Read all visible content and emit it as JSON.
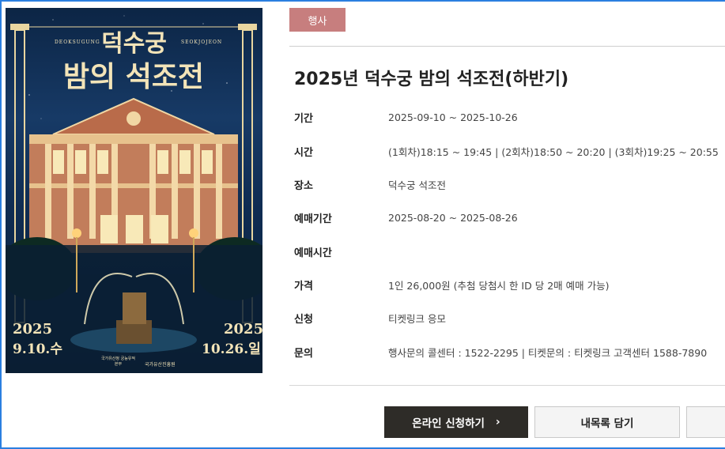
{
  "poster": {
    "title_line1": "덕수궁",
    "title_line2": "밤의 석조전",
    "en_left": "DEOKSUGUNG",
    "en_right": "SEOKJOJEON",
    "start_year": "2025",
    "start_date": "9.10.수",
    "end_year": "2025",
    "end_date": "10.26.일",
    "logo_left": "국가유산청 궁능유적본부",
    "logo_right": "국가유산진흥원"
  },
  "badge": "행사",
  "event_title": "2025년 덕수궁 밤의 석조전(하반기)",
  "info": [
    {
      "label": "기간",
      "value": "2025-09-10 ~ 2025-10-26"
    },
    {
      "label": "시간",
      "value": "(1회차)18:15 ~ 19:45 | (2회차)18:50 ~ 20:20 | (3회차)19:25 ~ 20:55"
    },
    {
      "label": "장소",
      "value": "덕수궁 석조전"
    },
    {
      "label": "예매기간",
      "value": "2025-08-20 ~ 2025-08-26"
    },
    {
      "label": "예매시간",
      "value": ""
    },
    {
      "label": "가격",
      "value": "1인 26,000원 (추첨 당첨시 한 ID 당 2매 예매 가능)"
    },
    {
      "label": "신청",
      "value": "티켓링크 응모"
    },
    {
      "label": "문의",
      "value": "행사문의 콜센터 : 1522-2295 | 티켓문의 : 티켓링크 고객센터 1588-7890"
    }
  ],
  "buttons": {
    "apply": "온라인 신청하기",
    "apply_icon": "chevron-right-icon",
    "mylist": "내목록 담기"
  },
  "colors": {
    "badge": "#c77e7e",
    "apply_button": "#2e2c28",
    "frame_border": "#2a7fe0"
  }
}
